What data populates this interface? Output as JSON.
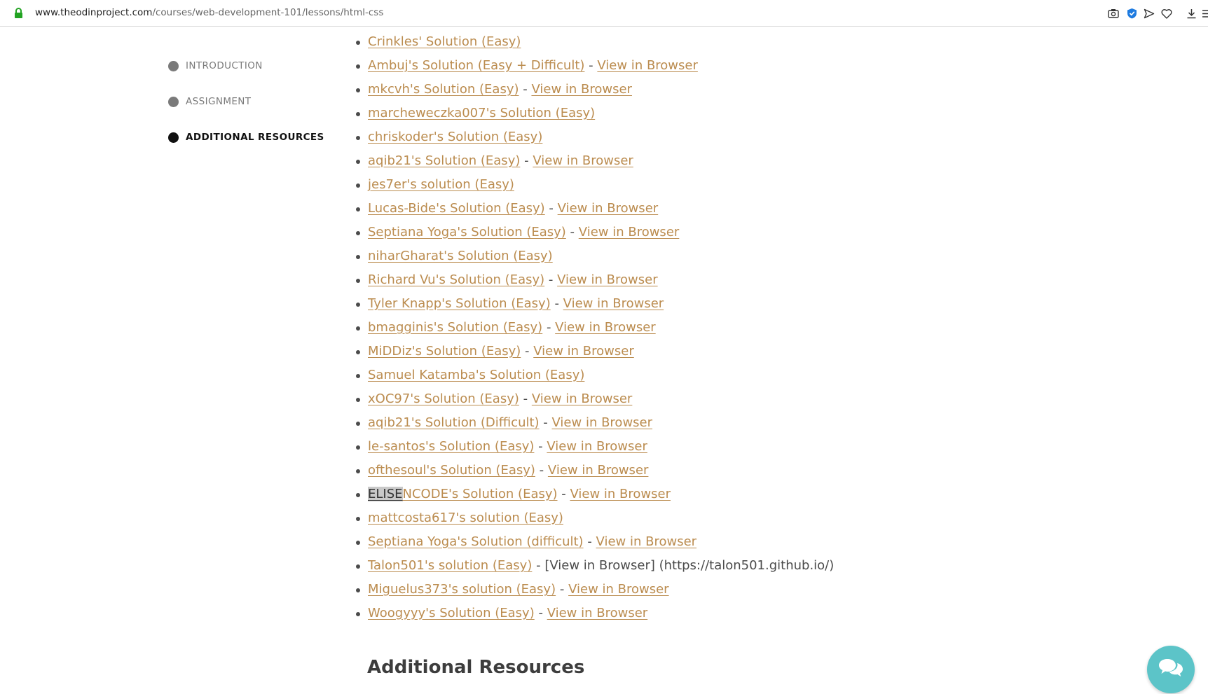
{
  "browser": {
    "url_domain": "www.theodinproject.com",
    "url_path": "/courses/web-development-101/lessons/html-css"
  },
  "sidebar": {
    "items": [
      {
        "label": "INTRODUCTION",
        "active": false
      },
      {
        "label": "ASSIGNMENT",
        "active": false
      },
      {
        "label": "ADDITIONAL RESOURCES",
        "active": true
      }
    ]
  },
  "solutions": [
    {
      "name": "Crinkles' Solution (Easy)",
      "separator": "",
      "browser": "",
      "note": ""
    },
    {
      "name": "Ambuj's Solution (Easy + Difficult)",
      "separator": " - ",
      "browser": "View in Browser",
      "note": ""
    },
    {
      "name": "mkcvh's Solution (Easy)",
      "separator": " - ",
      "browser": "View in Browser",
      "note": ""
    },
    {
      "name": "marcheweczka007's Solution (Easy)",
      "separator": "",
      "browser": "",
      "note": ""
    },
    {
      "name": "chriskoder's Solution (Easy)",
      "separator": "",
      "browser": "",
      "note": ""
    },
    {
      "name": "aqib21's Solution (Easy)",
      "separator": " - ",
      "browser": "View in Browser",
      "note": ""
    },
    {
      "name": "jes7er's solution (Easy)",
      "separator": "",
      "browser": "",
      "note": ""
    },
    {
      "name": "Lucas-Bide's Solution (Easy)",
      "separator": " - ",
      "browser": "View in Browser",
      "note": ""
    },
    {
      "name": "Septiana Yoga's Solution (Easy)",
      "separator": " - ",
      "browser": "View in Browser",
      "note": ""
    },
    {
      "name": "niharGharat's Solution (Easy)",
      "separator": "",
      "browser": "",
      "note": ""
    },
    {
      "name": "Richard Vu's Solution (Easy)",
      "separator": " - ",
      "browser": "View in Browser",
      "note": ""
    },
    {
      "name": "Tyler Knapp's Solution (Easy)",
      "separator": " - ",
      "browser": "View in Browser",
      "note": ""
    },
    {
      "name": "bmagginis's Solution (Easy)",
      "separator": " - ",
      "browser": "View in Browser",
      "note": ""
    },
    {
      "name": "MiDDiz's Solution (Easy)",
      "separator": " - ",
      "browser": "View in Browser",
      "note": ""
    },
    {
      "name": "Samuel Katamba's Solution (Easy)",
      "separator": "",
      "browser": "",
      "note": ""
    },
    {
      "name": "xOC97's Solution (Easy)",
      "separator": " - ",
      "browser": "View in Browser",
      "note": ""
    },
    {
      "name": "aqib21's Solution (Difficult)",
      "separator": " - ",
      "browser": "View in Browser",
      "note": ""
    },
    {
      "name": "le-santos's Solution (Easy)",
      "separator": " - ",
      "browser": "View in Browser",
      "note": ""
    },
    {
      "name": "ofthesoul's Solution (Easy)",
      "separator": " - ",
      "browser": "View in Browser",
      "note": ""
    },
    {
      "name": "ELISENCODE's Solution (Easy)",
      "highlight": "ELISE",
      "separator": " - ",
      "browser": "View in Browser",
      "note": ""
    },
    {
      "name": "mattcosta617's solution (Easy)",
      "separator": "",
      "browser": "",
      "note": ""
    },
    {
      "name": "Septiana Yoga's Solution (difficult)",
      "separator": " - ",
      "browser": "View in Browser",
      "note": ""
    },
    {
      "name": "Talon501's solution (Easy)",
      "separator": " - ",
      "browser": "",
      "note": "[View in Browser] (https://talon501.github.io/)"
    },
    {
      "name": "Miguelus373's solution (Easy)",
      "separator": " - ",
      "browser": "View in Browser",
      "note": ""
    },
    {
      "name": "Woogyyy's Solution (Easy)",
      "separator": " - ",
      "browser": "View in Browser",
      "note": ""
    }
  ],
  "section_heading": "Additional Resources",
  "colors": {
    "link": "#bb8c4f",
    "text": "#4b4b4b",
    "chat_button": "#5cc4c8",
    "lock": "#22a322"
  },
  "icons": [
    "lock-icon",
    "camera-icon",
    "shield-icon",
    "send-icon",
    "heart-icon",
    "download-icon",
    "menu-icon",
    "chat-icon"
  ]
}
